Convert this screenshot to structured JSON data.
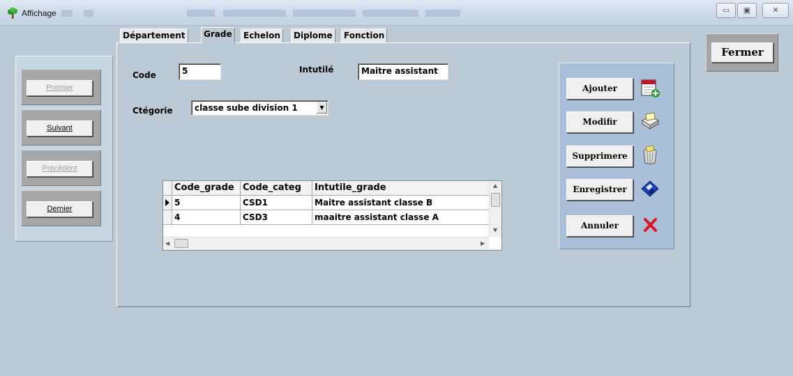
{
  "window": {
    "title": "Affichage",
    "controls": {
      "minimize": "▭",
      "maximize": "▣",
      "close": "✕"
    }
  },
  "nav": {
    "first": {
      "label": "Premier",
      "enabled": false
    },
    "next": {
      "label": "Suivant",
      "enabled": true
    },
    "previous": {
      "label": "Précédent",
      "enabled": false
    },
    "last": {
      "label": "Dernier",
      "enabled": true
    }
  },
  "tabs": [
    {
      "label": "Département",
      "active": false
    },
    {
      "label": "Grade",
      "active": true
    },
    {
      "label": "Echelon",
      "active": false
    },
    {
      "label": "Diplome",
      "active": false
    },
    {
      "label": "Fonction",
      "active": false
    }
  ],
  "form": {
    "code_label": "Code",
    "code_value": "5",
    "intitule_label": "Intutilé",
    "intitule_value": "Maitre assistant",
    "categorie_label": "Ctégorie",
    "categorie_value": "classe sube division 1"
  },
  "grid": {
    "columns": [
      "Code_grade",
      "Code_categ",
      "Intutile_grade"
    ],
    "rows": [
      {
        "code_grade": "5",
        "code_categ": "CSD1",
        "intitule_grade": "Maitre assistant classe B",
        "current": true
      },
      {
        "code_grade": "4",
        "code_categ": "CSD3",
        "intitule_grade": "maaitre assistant classe A",
        "current": false
      }
    ]
  },
  "actions": {
    "add": "Ajouter",
    "modify": "Modifir",
    "delete": "Supprimere",
    "save": "Enregistrer",
    "cancel": "Annuler"
  },
  "close_button": "Fermer",
  "colors": {
    "background": "#bccad6",
    "action_panel": "#a9c0d8",
    "cancel_red": "#e0141e",
    "save_blue": "#1f3fb8"
  },
  "icons": {
    "app": "tree-icon",
    "add": "calendar-add-icon",
    "modify": "edit-document-icon",
    "delete": "recycle-bin-icon",
    "save": "floppy-disk-icon",
    "cancel": "red-x-icon"
  }
}
